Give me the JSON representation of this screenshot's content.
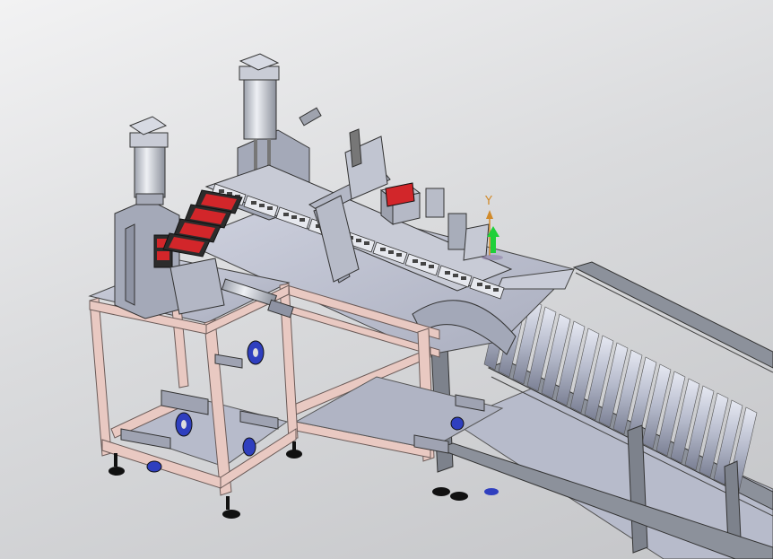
{
  "viewport": {
    "background_top": "#f2f2f3",
    "background_bottom": "#c4c5c8"
  },
  "colors": {
    "frame_tube": "#e9c9c2",
    "frame_edge": "#6b5b58",
    "steel": "#b9bdc9",
    "steel_dark": "#8e93a3",
    "aluminum_rail": "#7d828c",
    "roller": "#c3c8d8",
    "caster_wheel": "#2f3fbf",
    "display_red": "#d2262a",
    "axis_y": "#d18a2a",
    "axis_arrow": "#1fd03a"
  },
  "triad": {
    "y_label": "Y",
    "y_icon": "y-axis-arrow-icon"
  }
}
